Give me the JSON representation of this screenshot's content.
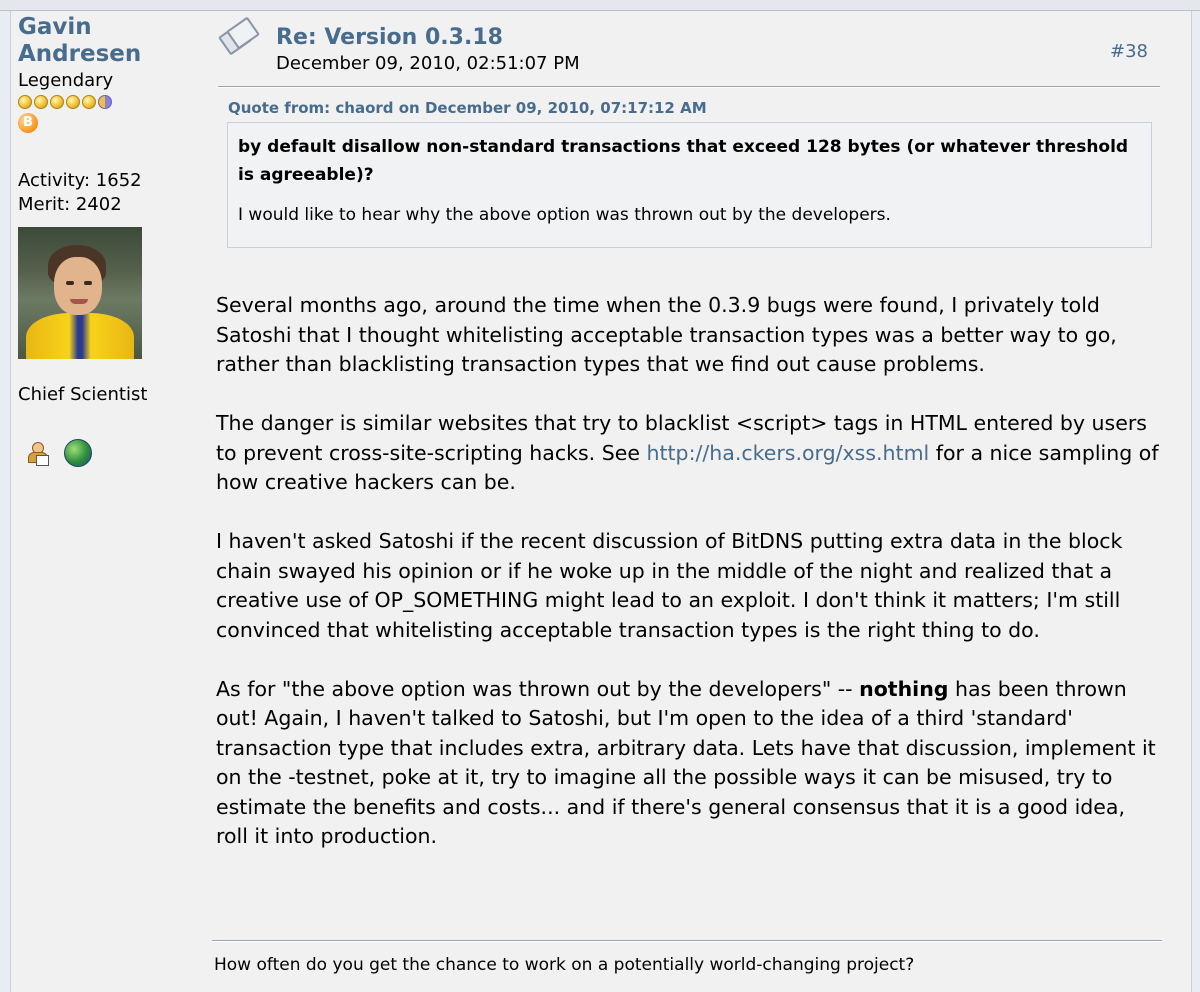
{
  "poster": {
    "name_line1": "Gavin",
    "name_line2": "Andresen",
    "rank": "Legendary",
    "activity": "Activity: 1652",
    "merit": "Merit: 2402",
    "custom_title": "Chief Scientist",
    "btc_badge": "B"
  },
  "post": {
    "subject": "Re: Version 0.3.18",
    "date": "December 09, 2010, 02:51:07 PM",
    "number": "#38"
  },
  "quote": {
    "header": "Quote from: chaord on December 09, 2010, 07:17:12 AM",
    "bold_text": "by default disallow non-standard transactions that exceed 128 bytes (or whatever threshold is agreeable)?",
    "text": "I would like to hear why the above option was thrown out by the developers."
  },
  "body": {
    "p1": "Several months ago, around the time when the 0.3.9 bugs were found, I privately told Satoshi that I thought whitelisting acceptable transaction types was a better way to go, rather than blacklisting transaction types that we find out cause problems.",
    "p2_before": "The danger is similar websites that try to blacklist <script> tags in HTML entered by users to prevent cross-site-scripting hacks.  See ",
    "p2_link": "http://ha.ckers.org/xss.html",
    "p2_after": " for a nice sampling of how creative hackers can be.",
    "p3": "I haven't asked Satoshi if the recent discussion of BitDNS putting extra data in the block chain swayed his opinion or if he woke up in the middle of the night and realized that a creative use of OP_SOMETHING might lead to an exploit.  I don't think it matters; I'm still convinced that whitelisting acceptable transaction types is the right thing to do.",
    "p4_before": "As for \"the above option was thrown out by the developers\"  -- ",
    "p4_bold": "nothing",
    "p4_after": " has been thrown out!  Again, I haven't talked to Satoshi, but I'm open to the idea of a third 'standard' transaction type that includes extra, arbitrary data.   Lets have that discussion, implement it on the -testnet, poke at it, try to imagine all the possible ways it can be misused, try to estimate the benefits and costs... and if there's general consensus that it is a good idea, roll it into production."
  },
  "signature": "How often do you get the chance to work on a potentially world-changing project?",
  "icons": [
    "topic-icon",
    "profile-icon",
    "globe-icon",
    "star-icon",
    "bitcoin-badge-icon"
  ],
  "colors": {
    "link": "#476c8e",
    "post_bg": "#f1f1f1",
    "quote_bg": "#f1f2f4"
  }
}
